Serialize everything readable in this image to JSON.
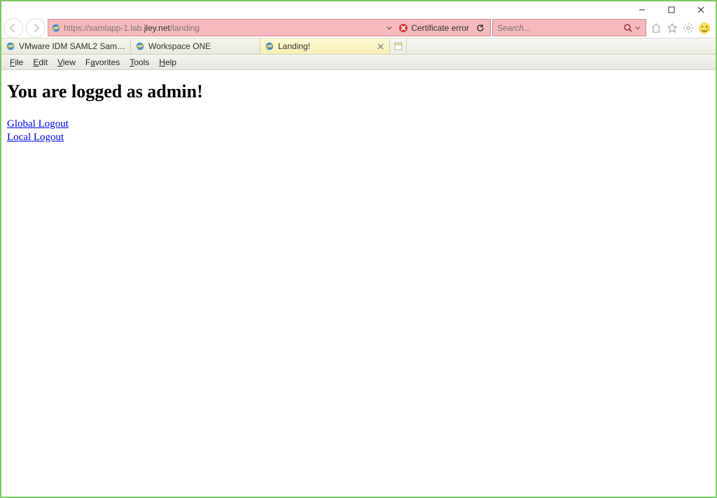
{
  "address_bar": {
    "url_prefix": "https://samlapp-1.lab.",
    "url_host": "jley.net",
    "url_suffix": "/landing",
    "certificate_error": "Certificate error"
  },
  "search": {
    "placeholder": "Search..."
  },
  "tabs": [
    {
      "label": "VMware IDM SAML2 Sample A…",
      "active": false
    },
    {
      "label": "Workspace ONE",
      "active": false
    },
    {
      "label": "Landing!",
      "active": true
    }
  ],
  "menu": {
    "file": "File",
    "edit": "Edit",
    "view": "View",
    "favorites": "Favorites",
    "tools": "Tools",
    "help": "Help"
  },
  "content": {
    "heading": "You are logged as admin!",
    "links": {
      "global_logout": "Global Logout",
      "local_logout": "Local Logout"
    }
  }
}
